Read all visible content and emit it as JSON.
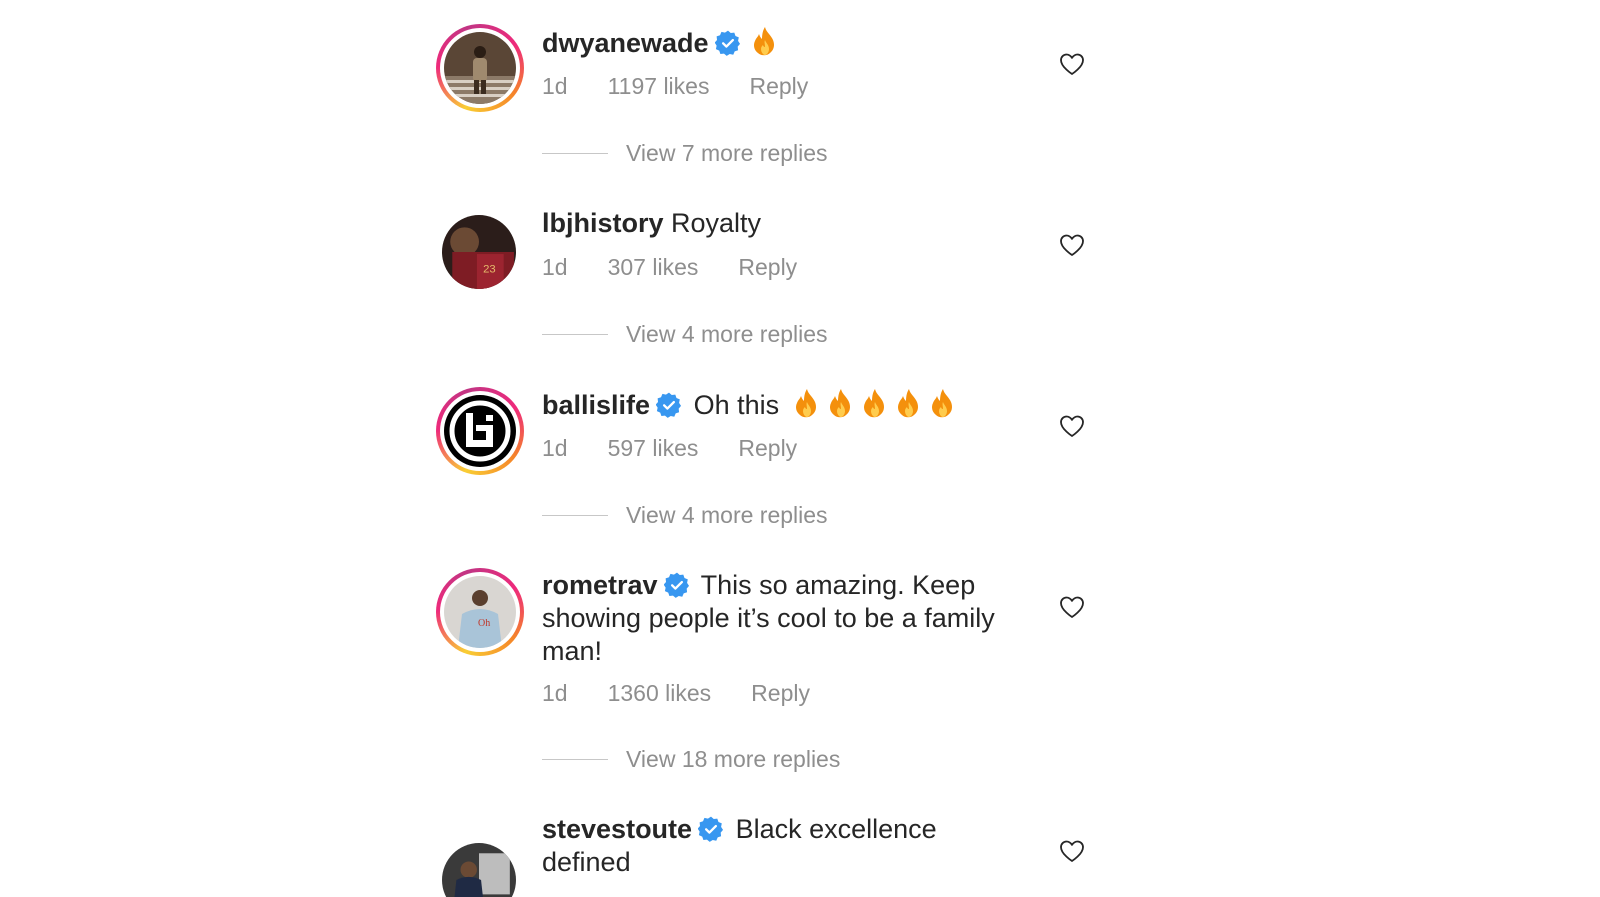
{
  "comments": [
    {
      "username": "dwyanewade",
      "verified": true,
      "text": "",
      "text_lines": [],
      "fire_count": 1,
      "time": "1d",
      "likes": "1197 likes",
      "reply_label": "Reply",
      "view_replies": "View 7 more replies"
    },
    {
      "username": "lbjhistory",
      "verified": false,
      "text": "Royalty",
      "time": "1d",
      "likes": "307 likes",
      "reply_label": "Reply",
      "view_replies": "View 4 more replies"
    },
    {
      "username": "ballislife",
      "verified": true,
      "text": "Oh this",
      "fire_count": 5,
      "time": "1d",
      "likes": "597 likes",
      "reply_label": "Reply",
      "view_replies": "View 4 more replies"
    },
    {
      "username": "rometrav",
      "verified": true,
      "text": "This so amazing. Keep showing people it’s cool to be a family man!",
      "time": "1d",
      "likes": "1360 likes",
      "reply_label": "Reply",
      "view_replies": "View 18 more replies"
    },
    {
      "username": "stevestoute",
      "verified": true,
      "text": "Black excellence defined"
    }
  ],
  "icons": {
    "verified": "verified-badge-icon",
    "fire": "fire-emoji-icon",
    "heart": "heart-outline-icon"
  },
  "colors": {
    "text": "#262626",
    "secondary": "#8e8e8e",
    "verified": "#3897f0",
    "story_ring": "#ee2a7b"
  }
}
